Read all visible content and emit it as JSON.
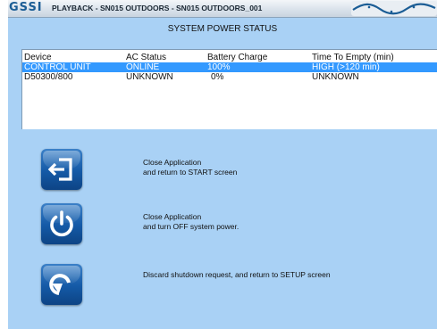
{
  "titlebar": {
    "logo_text": "GSSI",
    "title": "PLAYBACK - SN015 OUTDOORS - SN015 OUTDOORS_001"
  },
  "header": {
    "title": "SYSTEM POWER STATUS"
  },
  "table": {
    "columns": [
      "Device",
      "AC Status",
      "Battery Charge",
      "Time To Empty (min)"
    ],
    "rows": [
      [
        "CONTROL UNIT",
        "ONLINE",
        "100%",
        "HIGH (>120 min)"
      ],
      [
        "D50300/800",
        "UNKNOWN",
        "0%",
        "UNKNOWN"
      ]
    ],
    "selected_row": 0
  },
  "actions": [
    {
      "icon": "exit-icon",
      "line1": "Close Application",
      "line2": "and return to START screen"
    },
    {
      "icon": "power-icon",
      "line1": "Close Application",
      "line2": "and turn OFF system power."
    },
    {
      "icon": "undo-icon",
      "line1": "Discard shutdown request, and return to SETUP screen",
      "line2": ""
    }
  ],
  "colors": {
    "background": "#a9d1f5",
    "selection": "#3399ff",
    "button": "#1459a6"
  }
}
